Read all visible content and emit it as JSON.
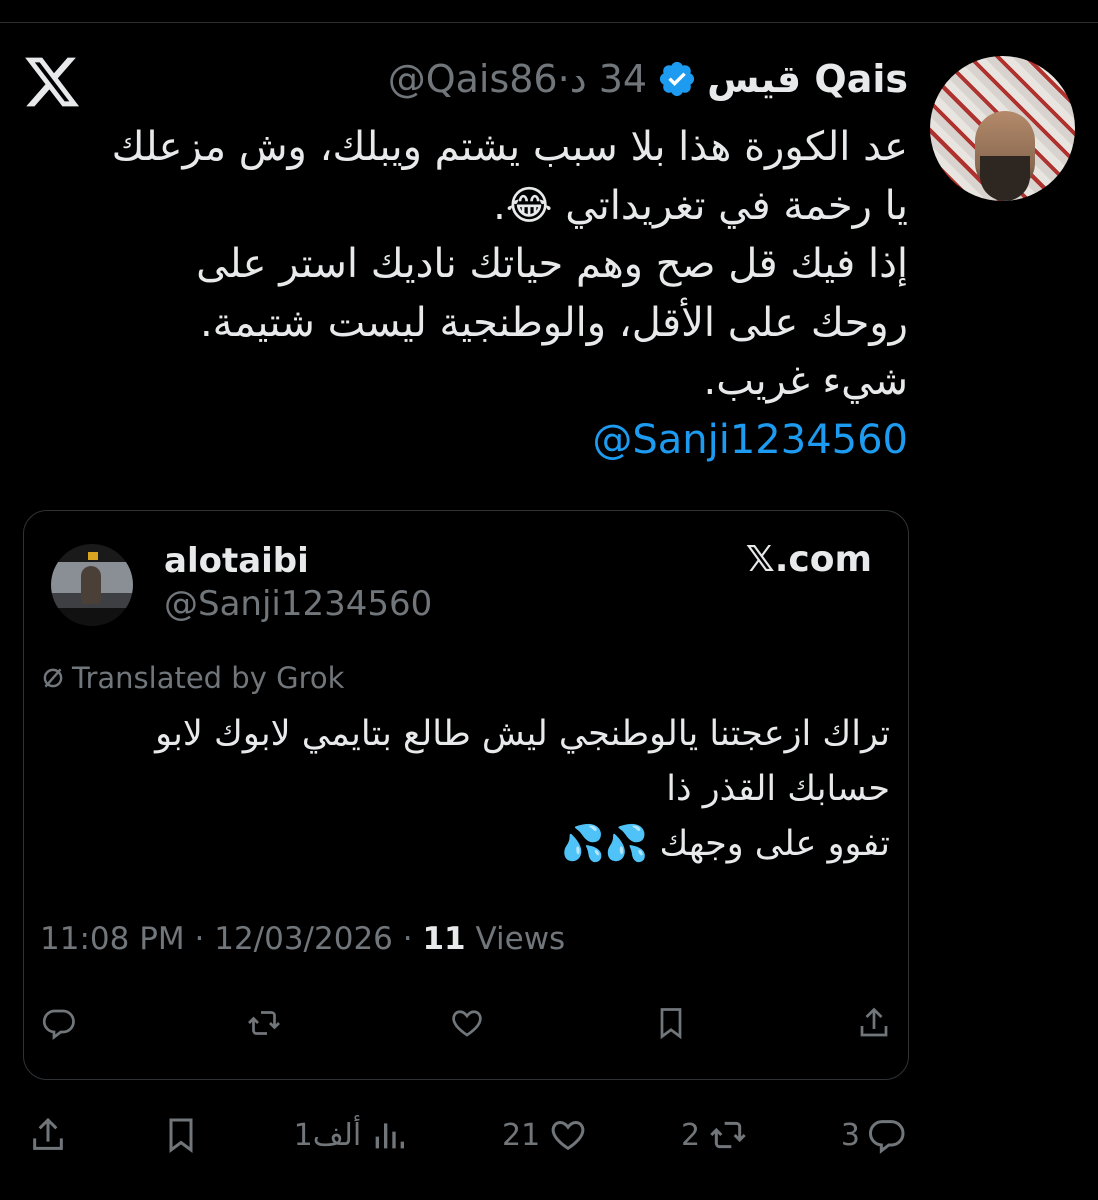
{
  "tweet": {
    "display_name": "قيس Qais",
    "handle": "@Qais86",
    "time_ago": "34 د",
    "body_lines": [
      "عد الكورة هذا بلا سبب يشتم ويبلك، وش مزعلك يا رخمة في تغريداتي 😂.",
      "إذا فيك قل صح وهم حياتك ناديك استر على روحك على الأقل، والوطنجية ليست شتيمة.",
      "شيء غريب."
    ],
    "mention": "@Sanji1234560"
  },
  "quote": {
    "name": "alotaibi",
    "handle": "@Sanji1234560",
    "source": "𝕏.com",
    "translated_label": "Translated by Grok",
    "body_lines": [
      "تراك ازعجتنا يالوطنجي ليش طالع بتايمي لابوك لابو حسابك القذر ذا",
      "تفوو على وجهك 💦💦"
    ],
    "time": "11:08 PM",
    "date": "12/03/2026",
    "views_count": "11",
    "views_label": "Views"
  },
  "actions": {
    "replies": "3",
    "reposts": "2",
    "likes": "21",
    "views": "1ألف"
  },
  "colors": {
    "background": "#000000",
    "text": "#e7e9ea",
    "muted": "#71767b",
    "accent": "#1d9bf0"
  },
  "icons": [
    "x-logo-icon",
    "verified-badge-icon",
    "reply-icon",
    "repost-icon",
    "like-icon",
    "views-icon",
    "bookmark-icon",
    "share-icon",
    "translate-slash-icon"
  ]
}
